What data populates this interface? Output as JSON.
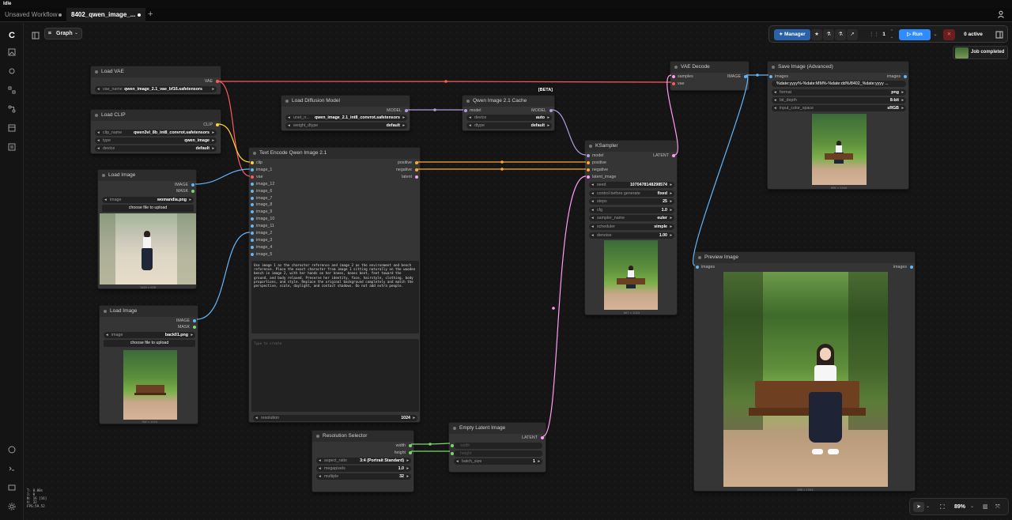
{
  "window": {
    "title": "Idle"
  },
  "tabs": [
    {
      "label": "Unsaved Workflow"
    },
    {
      "label": "8402_qwen_image_..."
    }
  ],
  "toolbar": {
    "graph_label": "Graph",
    "manager_label": "Manager",
    "queue_count": "1",
    "run_label": "Run",
    "active_label": "0 active",
    "job_status": "Job completed"
  },
  "zoom": {
    "level": "89%"
  },
  "stats": {
    "t": "T: 0.00s",
    "i": "I: 0",
    "n": "N: 16 [16]",
    "v": "V: 32",
    "fps": "FPS:59.52"
  },
  "nodes": {
    "load_vae": {
      "title": "Load VAE",
      "out": "VAE",
      "w_label": "vae_name",
      "w_value": "qwen_image_2.1_vae_bf16.safetensors"
    },
    "load_clip": {
      "title": "Load CLIP",
      "out": "CLIP",
      "widgets": [
        {
          "label": "clip_name",
          "value": "qwen3vl_8b_int8_convrot.safetensors"
        },
        {
          "label": "type",
          "value": "qwen_image"
        },
        {
          "label": "device",
          "value": "default"
        }
      ]
    },
    "load_image1": {
      "title": "Load Image",
      "out1": "IMAGE",
      "out2": "MASK",
      "w_label": "image",
      "w_value": "womandia.png",
      "button": "choose file to upload",
      "caption": "1104 × 928"
    },
    "load_image2": {
      "title": "Load Image",
      "out1": "IMAGE",
      "out2": "MASK",
      "w_label": "image",
      "w_value": "back01.png",
      "button": "choose file to upload",
      "caption": "768 × 1024"
    },
    "load_diffusion": {
      "title": "Load Diffusion Model",
      "out": "MODEL",
      "widgets": [
        {
          "label": "unet_n...",
          "value": "qwen_image_2.1_int8_convrot.safetensors"
        },
        {
          "label": "weight_dtype",
          "value": "default"
        }
      ]
    },
    "qwen_cache": {
      "title": "Qwen Image 2.1 Cache",
      "badge": "[BETA]",
      "in": "model",
      "out": "MODEL",
      "widgets": [
        {
          "label": "device",
          "value": "auto"
        },
        {
          "label": "dtype",
          "value": "default"
        }
      ]
    },
    "text_encode": {
      "title": "Text Encode Qwen Image 2.1",
      "inputs": [
        "clip",
        "image_1",
        "vae",
        "image_12",
        "image_6",
        "image_7",
        "image_8",
        "image_9",
        "image_10",
        "image_11",
        "image_2",
        "image_3",
        "image_4",
        "image_5"
      ],
      "outputs": [
        "positive",
        "negative",
        "latent"
      ],
      "prompt": "Use image 1 as the character reference and image 2 as the environment and bench reference. Place the exact character from image 1 sitting naturally on the wooden bench in image 2, with her hands on her knees, knees bent, feet toward the ground, and body relaxed. Preserve her identity, face, hairstyle, clothing, body proportions, and style. Replace the original background completely and match the perspective, scale, daylight, and contact shadows. Do not add extra people.",
      "neg_placeholder": "Type to create",
      "resolution_label": "resolution",
      "resolution_value": "1024"
    },
    "ksampler": {
      "title": "KSampler",
      "inputs": [
        "model",
        "positive",
        "negative",
        "latent_image"
      ],
      "out": "LATENT",
      "widgets": [
        {
          "label": "seed",
          "value": "1070478148298574"
        },
        {
          "label": "control before generate",
          "value": "fixed"
        },
        {
          "label": "steps",
          "value": "25"
        },
        {
          "label": "cfg",
          "value": "1.0"
        },
        {
          "label": "sampler_name",
          "value": "euler"
        },
        {
          "label": "scheduler",
          "value": "simple"
        },
        {
          "label": "denoise",
          "value": "1.00"
        }
      ],
      "caption": "667 × 1024"
    },
    "vae_decode": {
      "title": "VAE Decode",
      "inputs": [
        "samples",
        "vae"
      ],
      "out": "IMAGE"
    },
    "save_image": {
      "title": "Save Image (Advanced)",
      "in": "images",
      "out": "images",
      "filename": "%date:yyyy%-%date:MM%-%date:dd%/8402_%date:yyyy ...",
      "widgets": [
        {
          "label": "format",
          "value": "png"
        },
        {
          "label": "bit_depth",
          "value": "8-bit"
        },
        {
          "label": "input_color_space",
          "value": "sRGB"
        }
      ],
      "caption": "896 × 1344"
    },
    "preview_image": {
      "title": "Preview Image",
      "in": "images",
      "out": "images",
      "caption": "896 × 1344"
    },
    "resolution_selector": {
      "title": "Resolution Selector",
      "outputs": [
        "width",
        "height"
      ],
      "widgets": [
        {
          "label": "aspect_ratio",
          "value": "3:4 (Portrait Standard)"
        },
        {
          "label": "megapixels",
          "value": "1.0"
        },
        {
          "label": "multiple",
          "value": "32"
        }
      ]
    },
    "empty_latent": {
      "title": "Empty Latent Image",
      "inputs": [
        "width",
        "height"
      ],
      "out": "LATENT",
      "w_label": "batch_size",
      "w_value": "1"
    }
  },
  "colors": {
    "vae": "#ff5a5a",
    "clip": "#ffd23c",
    "model": "#b39ddb",
    "image": "#64b5f6",
    "conditioning": "#ffa931",
    "latent": "#ff9cf5",
    "int": "#7cd66c",
    "accent": "#2f8cff"
  }
}
